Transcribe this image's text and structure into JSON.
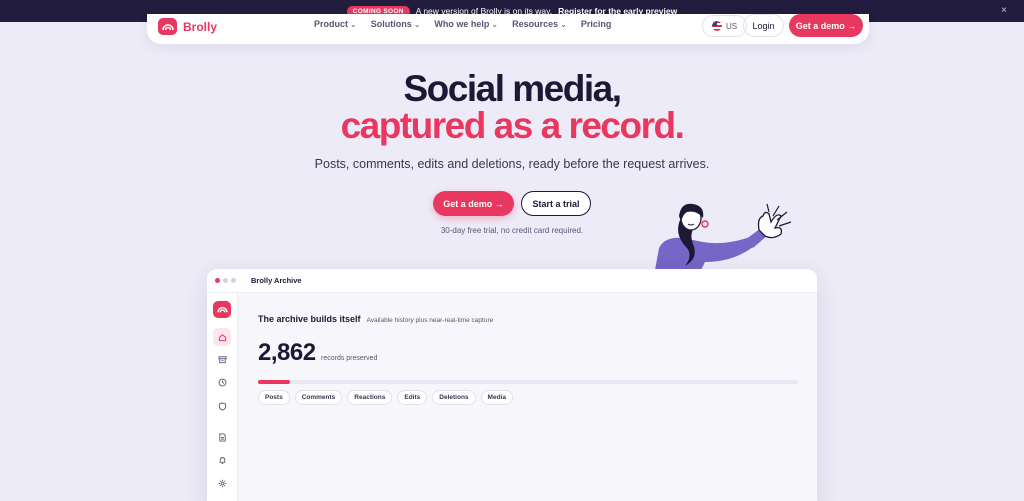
{
  "announcement": {
    "pill": "COMING SOON",
    "text": "A new version of Brolly is on its way.",
    "link": "Register for the early preview",
    "close": "×"
  },
  "nav": {
    "brand": "Brolly",
    "links": [
      {
        "label": "Product",
        "chevron": true
      },
      {
        "label": "Solutions",
        "chevron": true
      },
      {
        "label": "Who we help",
        "chevron": true
      },
      {
        "label": "Resources",
        "chevron": true
      },
      {
        "label": "Pricing",
        "chevron": false
      }
    ],
    "locale": "US",
    "login": "Login",
    "cta": "Get a demo →"
  },
  "hero": {
    "title_line1": "Social media,",
    "title_line2": "captured as a record.",
    "subtitle": "Posts, comments, edits and deletions, ready before the request arrives.",
    "primary_cta": "Get a demo →",
    "secondary_cta": "Start a trial",
    "note": "30-day free trial, no credit card required."
  },
  "app": {
    "window_title": "Brolly Archive",
    "sidebar_icons": [
      "home-icon",
      "archive-icon",
      "clock-icon",
      "shield-icon",
      "document-icon",
      "bell-icon",
      "settings-icon"
    ],
    "heading": "The archive builds itself",
    "heading_sub": "Available history plus near-real-time capture",
    "count": "2,862",
    "count_label": "records preserved",
    "progress": 0.06,
    "chips": [
      "Posts",
      "Comments",
      "Reactions",
      "Edits",
      "Deletions",
      "Media"
    ]
  },
  "colors": {
    "accent": "#e8385f",
    "dark": "#1d1836",
    "background": "#eeebf8",
    "announcement_bg": "#221c3e"
  }
}
